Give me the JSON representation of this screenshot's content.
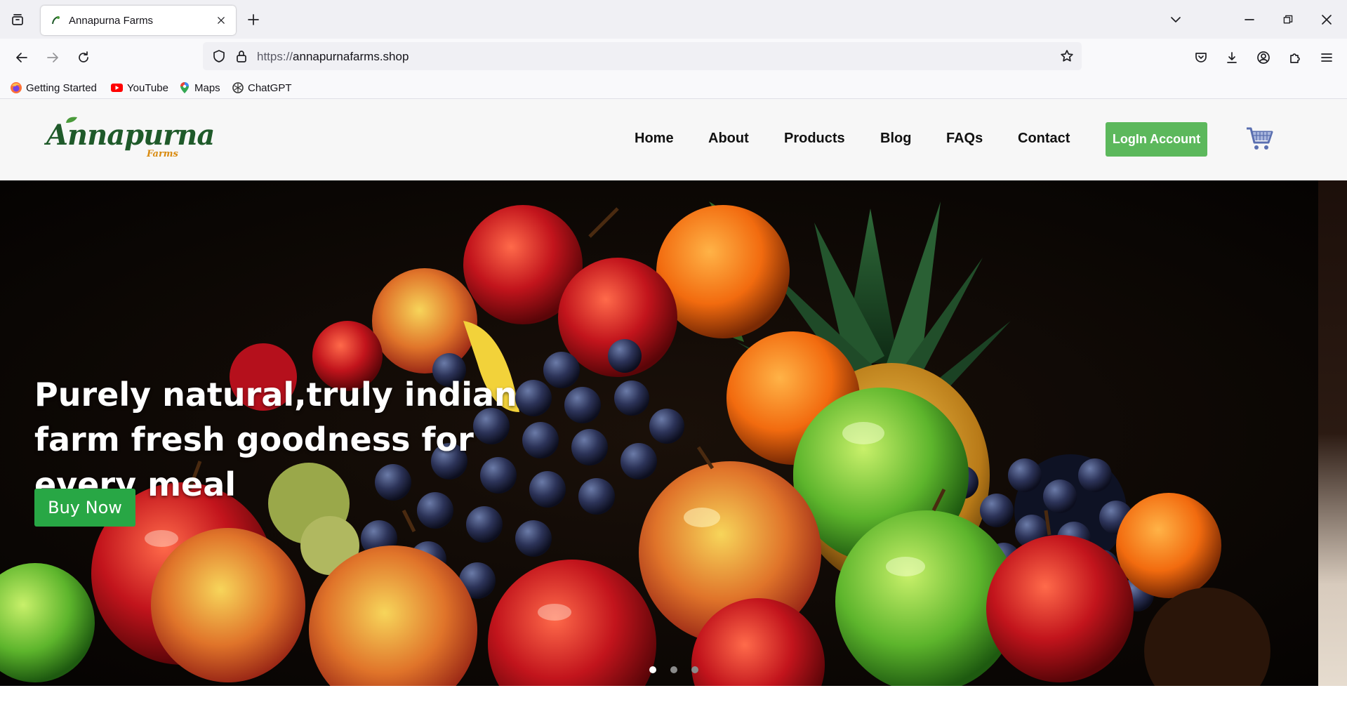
{
  "browser": {
    "tab_title": "Annapurna Farms",
    "url_protocol": "https://",
    "url_domain": "annapurnafarms.shop",
    "bookmarks": [
      {
        "label": "Getting Started",
        "icon": "firefox-icon"
      },
      {
        "label": "YouTube",
        "icon": "youtube-icon"
      },
      {
        "label": "Maps",
        "icon": "maps-pin-icon"
      },
      {
        "label": "ChatGPT",
        "icon": "chatgpt-icon"
      }
    ]
  },
  "site": {
    "logo_main": "Annapurna",
    "logo_sub": "Farms",
    "nav": [
      "Home",
      "About",
      "Products",
      "Blog",
      "FAQs",
      "Contact"
    ],
    "login_label": "LogIn Account",
    "colors": {
      "brand_green": "#1f5a2a",
      "accent_orange": "#d98b10",
      "login_green": "#5cb85c",
      "buy_green": "#28a745"
    }
  },
  "hero": {
    "title": "Purely natural,truly indian farm fresh goodness for every meal",
    "button_label": "Buy Now",
    "carousel": {
      "slides": 3,
      "active": 1
    }
  }
}
